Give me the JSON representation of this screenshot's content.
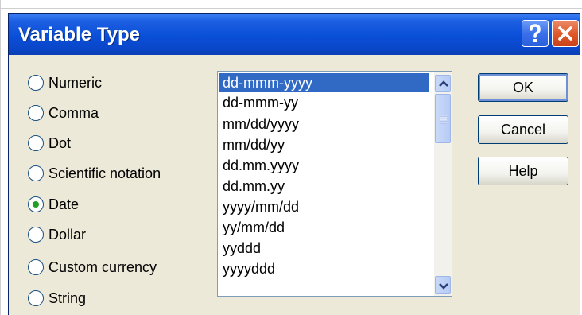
{
  "dialog": {
    "title": "Variable Type"
  },
  "titlebar": {
    "help_icon": "question-mark-icon",
    "close_icon": "close-x-icon"
  },
  "radio_options": [
    {
      "label": "Numeric",
      "checked": false
    },
    {
      "label": "Comma",
      "checked": false
    },
    {
      "label": "Dot",
      "checked": false
    },
    {
      "label": "Scientific notation",
      "checked": false
    },
    {
      "label": "Date",
      "checked": true
    },
    {
      "label": "Dollar",
      "checked": false
    },
    {
      "label": "Custom currency",
      "checked": false
    },
    {
      "label": "String",
      "checked": false
    }
  ],
  "formats": {
    "selected": "dd-mmm-yyyy",
    "items": [
      "dd-mmm-yyyy",
      "dd-mmm-yy",
      "mm/dd/yyyy",
      "mm/dd/yy",
      "dd.mm.yyyy",
      "dd.mm.yy",
      "yyyy/mm/dd",
      "yy/mm/dd",
      "yyddd",
      "yyyyddd"
    ]
  },
  "buttons": {
    "ok_label": "OK",
    "cancel_label": "Cancel",
    "help_label": "Help"
  },
  "colors": {
    "titlebar": "#0a4fd8",
    "selection": "#316ac5",
    "dialog_bg": "#ece9d8",
    "close_button": "#e05a2c"
  }
}
